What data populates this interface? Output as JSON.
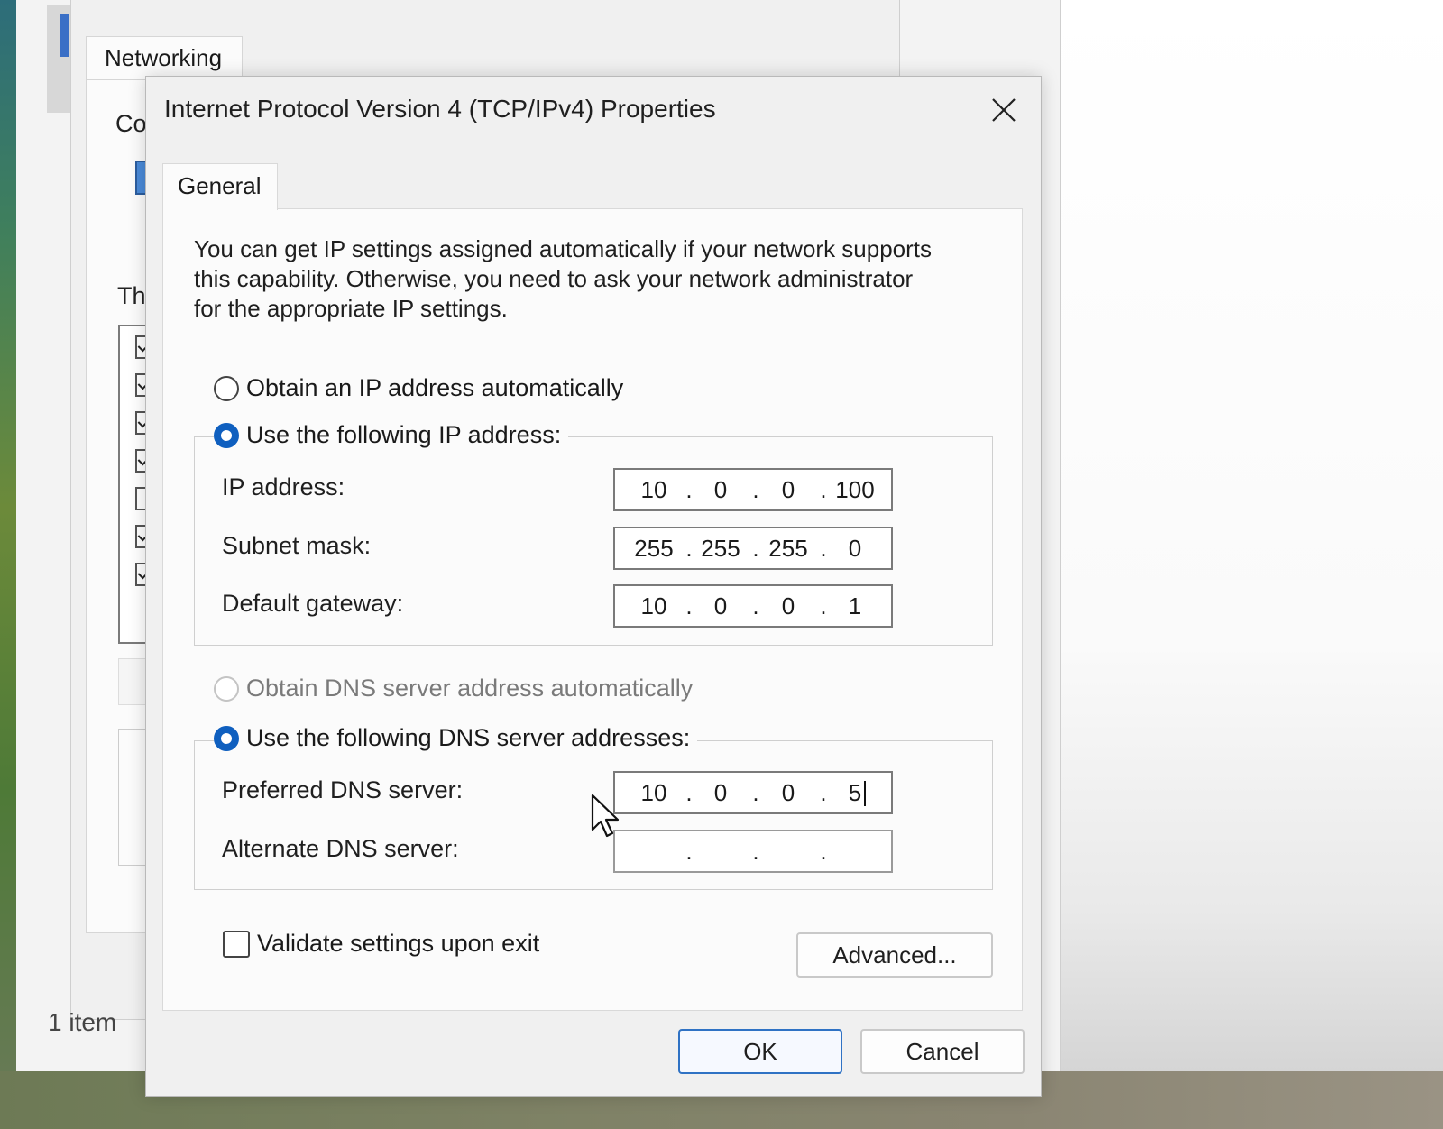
{
  "background_window": {
    "tab_label": "Networking",
    "fragment_connect": "Co",
    "fragment_this": "Th",
    "status_text": "1 item"
  },
  "dialog": {
    "title": "Internet Protocol Version 4 (TCP/IPv4) Properties",
    "tab_label": "General",
    "intro_lines": [
      "You can get IP settings assigned automatically if your network supports",
      "this capability. Otherwise, you need to ask your network administrator",
      "for the appropriate IP settings."
    ],
    "ip_auto_label": "Obtain an IP address automatically",
    "ip_manual_label": "Use the following IP address:",
    "ip_mode": "manual",
    "ip_fields": [
      {
        "label": "IP address:",
        "octets": [
          "10",
          "0",
          "0",
          "100"
        ]
      },
      {
        "label": "Subnet mask:",
        "octets": [
          "255",
          "255",
          "255",
          "0"
        ]
      },
      {
        "label": "Default gateway:",
        "octets": [
          "10",
          "0",
          "0",
          "1"
        ]
      }
    ],
    "dns_auto_label": "Obtain DNS server address automatically",
    "dns_manual_label": "Use the following DNS server addresses:",
    "dns_mode": "manual",
    "dns_fields": [
      {
        "label": "Preferred DNS server:",
        "octets": [
          "10",
          "0",
          "0",
          "5"
        ]
      },
      {
        "label": "Alternate DNS server:",
        "octets": [
          "",
          "",
          "",
          ""
        ]
      }
    ],
    "validate_label": "Validate settings upon exit",
    "validate_checked": false,
    "advanced_button": "Advanced...",
    "ok_button": "OK",
    "cancel_button": "Cancel"
  },
  "colors": {
    "accent": "#0f5fbf",
    "dialog_bg": "#f0f0f0",
    "panel_bg": "#fbfbfb"
  },
  "icons": {
    "close": "close-icon",
    "cursor": "mouse-pointer-icon"
  }
}
